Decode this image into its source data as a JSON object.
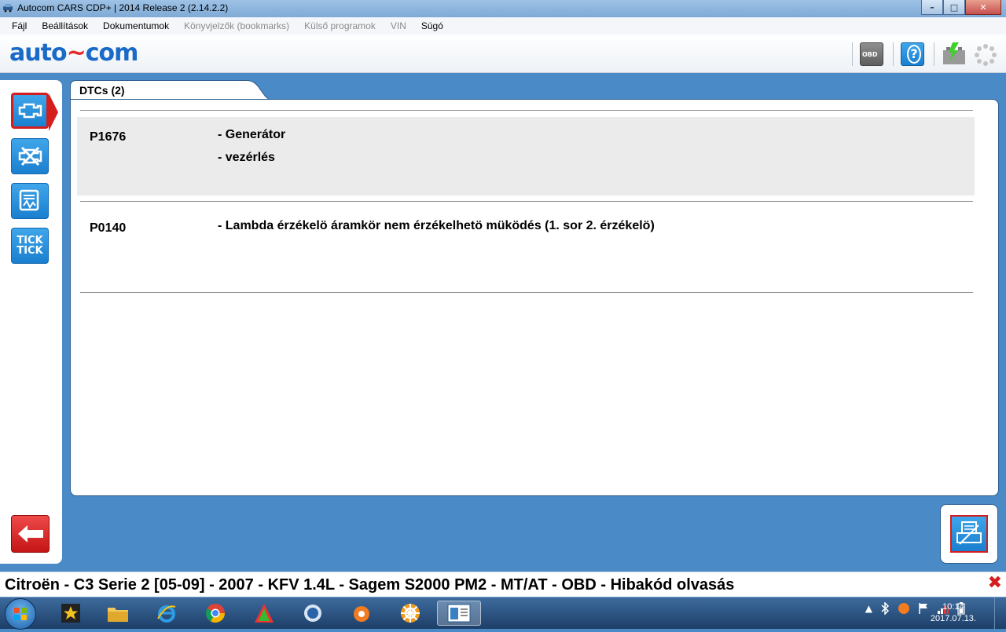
{
  "window": {
    "title": "Autocom CARS CDP+ | 2014 Release 2 (2.14.2.2)",
    "minimize_label": "–",
    "maximize_label": "□",
    "close_label": "✕"
  },
  "menu": {
    "items": [
      {
        "label": "Fájl",
        "enabled": true
      },
      {
        "label": "Beállítások",
        "enabled": true
      },
      {
        "label": "Dokumentumok",
        "enabled": true
      },
      {
        "label": "Könyvjelzők (bookmarks)",
        "enabled": false
      },
      {
        "label": "Külső programok",
        "enabled": false
      },
      {
        "label": "VIN",
        "enabled": false
      },
      {
        "label": "Súgó",
        "enabled": true
      }
    ]
  },
  "header": {
    "logo_left": "auto",
    "logo_tilde": "~",
    "logo_right": "com",
    "obd_badge": "OBD",
    "help_icon": "?"
  },
  "sidebar": {
    "tick_line1": "TICK",
    "tick_line2": "TICK"
  },
  "tab": {
    "label": "DTCs (2)"
  },
  "dtcs": [
    {
      "code": "P1676",
      "lines": [
        "- Generátor",
        "- vezérlés"
      ]
    },
    {
      "code": "P0140",
      "lines": [
        "- Lambda érzékelö áramkör nem érzékelhetö müködés (1. sor 2. érzékelö)"
      ]
    }
  ],
  "status": {
    "text": "Citroën - C3 Serie 2 [05-09] - 2007 - KFV 1.4L - Sagem S2000 PM2 - MT/AT - OBD - Hibakód olvasás",
    "close": "✖"
  },
  "taskbar": {
    "tray_arrow": "▲",
    "clock_time": "10:14",
    "clock_date": "2017.07.13."
  },
  "colors": {
    "accent": "#1a7fcf",
    "danger": "#d51d1d",
    "background": "#4a8ac6"
  }
}
